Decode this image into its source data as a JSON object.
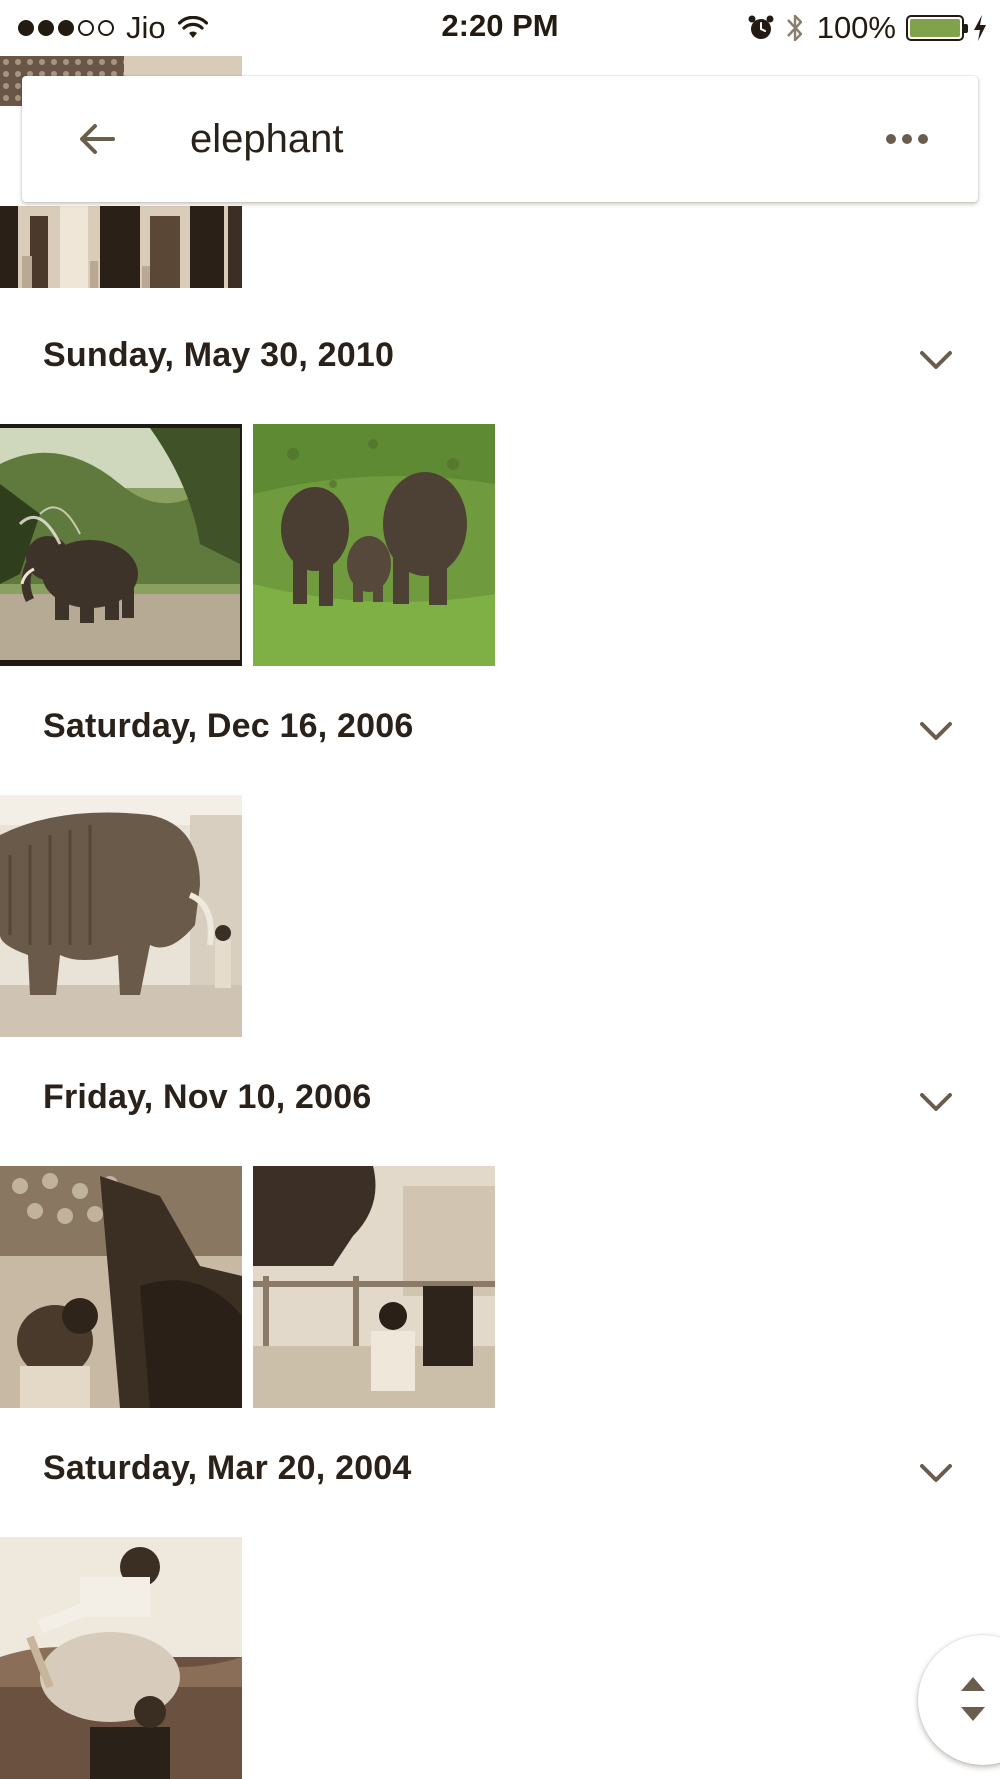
{
  "status_bar": {
    "carrier": "Jio",
    "time": "2:20 PM",
    "battery_percent": "100%",
    "battery_level": 1.0,
    "signal_bars_filled": 3,
    "signal_bars_total": 5,
    "icons": [
      "wifi-icon",
      "alarm-icon",
      "bluetooth-icon",
      "charging-bolt-icon"
    ]
  },
  "search": {
    "query": "elephant",
    "back_icon": "arrow-left-icon",
    "more_icon": "more-horizontal-icon"
  },
  "sections": [
    {
      "date": "Sunday, May 30, 2010",
      "photos": [
        "elephant-in-forest-spraying-water",
        "elephant-family-on-grass"
      ]
    },
    {
      "date": "Saturday, Dec 16, 2006",
      "photos": [
        "woolly-mammoth-statue-with-child"
      ]
    },
    {
      "date": "Friday, Nov 10, 2006",
      "photos": [
        "children-near-decorated-elephant-statue",
        "child-sitting-under-elephant-statue"
      ]
    },
    {
      "date": "Saturday, Mar 20, 2004",
      "photos": [
        "child-on-toy-elephant"
      ]
    }
  ],
  "colors": {
    "text": "#2a221a",
    "icon": "#6b5d4c",
    "battery_fill": "#7fa24a",
    "background": "#ffffff"
  },
  "scroll_handle_icon": "scroll-up-down-icon"
}
